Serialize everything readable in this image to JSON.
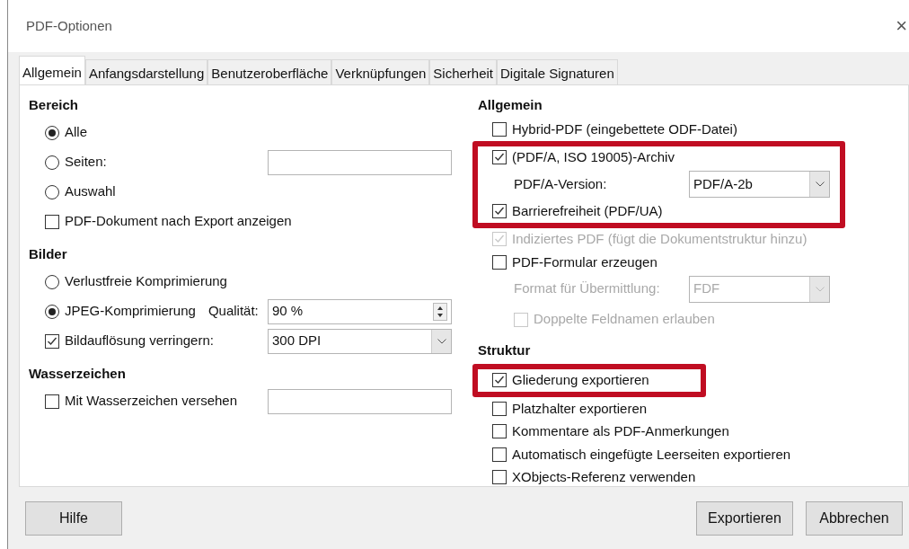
{
  "window": {
    "title": "PDF-Optionen",
    "close": "×"
  },
  "tabs": [
    {
      "label": "Allgemein",
      "selected": true
    },
    {
      "label": "Anfangsdarstellung",
      "selected": false
    },
    {
      "label": "Benutzeroberfläche",
      "selected": false
    },
    {
      "label": "Verknüpfungen",
      "selected": false
    },
    {
      "label": "Sicherheit",
      "selected": false
    },
    {
      "label": "Digitale Signaturen",
      "selected": false
    }
  ],
  "left_sections": [
    {
      "heading": "Bereich",
      "items": [
        {
          "kind": "radio",
          "label": "Alle",
          "selected": true
        },
        {
          "kind": "radio",
          "label": "Seiten:",
          "selected": false,
          "field": {
            "kind": "text"
          }
        },
        {
          "kind": "radio",
          "label": "Auswahl",
          "selected": false
        },
        {
          "kind": "checkbox",
          "label": "PDF-Dokument nach Export anzeigen",
          "checked": false
        }
      ]
    },
    {
      "heading": "Bilder",
      "items": [
        {
          "kind": "radio",
          "label": "Verlustfreie Komprimierung",
          "selected": false
        },
        {
          "kind": "radio",
          "label": "JPEG-Komprimierung",
          "selected": true,
          "field_label": "Qualität:",
          "field": {
            "kind": "spin",
            "value": "90 %"
          }
        },
        {
          "kind": "checkbox",
          "label": "Bildauflösung verringern:",
          "checked": true,
          "field": {
            "kind": "select",
            "value": "300 DPI"
          }
        }
      ]
    },
    {
      "heading": "Wasserzeichen",
      "items": [
        {
          "kind": "checkbox",
          "label": "Mit Wasserzeichen versehen",
          "checked": false,
          "field": {
            "kind": "text"
          }
        }
      ]
    }
  ],
  "right_sections": [
    {
      "heading": "Allgemein",
      "items": [
        {
          "kind": "checkbox",
          "label": "Hybrid-PDF (eingebettete ODF-Datei)",
          "checked": false,
          "disabled": false,
          "highlighted": false
        },
        {
          "kind": "checkbox",
          "label": "(PDF/A, ISO 19005)-Archiv",
          "checked": true,
          "disabled": false,
          "highlighted": true
        },
        {
          "kind": "select",
          "label": "PDF/A-Version:",
          "value": "PDF/A-2b",
          "disabled": false,
          "highlighted": true
        },
        {
          "kind": "checkbox",
          "label": "Barrierefreiheit (PDF/UA)",
          "checked": true,
          "disabled": false,
          "highlighted": true
        },
        {
          "kind": "checkbox",
          "label": "Indiziertes PDF (fügt die Dokumentstruktur hinzu)",
          "checked": true,
          "disabled": true,
          "highlighted": false
        },
        {
          "kind": "checkbox",
          "label": "PDF-Formular erzeugen",
          "checked": false,
          "disabled": false,
          "highlighted": false
        },
        {
          "kind": "select",
          "label": "Format für Übermittlung:",
          "value": "FDF",
          "disabled": true,
          "highlighted": false
        },
        {
          "kind": "subcheckbox",
          "label": "Doppelte Feldnamen erlauben",
          "checked": false,
          "disabled": true,
          "highlighted": false
        }
      ]
    },
    {
      "heading": "Struktur",
      "items": [
        {
          "kind": "checkbox",
          "label": "Gliederung exportieren",
          "checked": true,
          "disabled": false,
          "highlighted": true
        },
        {
          "kind": "checkbox",
          "label": "Platzhalter exportieren",
          "checked": false,
          "disabled": false,
          "highlighted": false
        },
        {
          "kind": "checkbox",
          "label": "Kommentare als PDF-Anmerkungen",
          "checked": false,
          "disabled": false,
          "highlighted": false
        },
        {
          "kind": "checkbox",
          "label": "Automatisch eingefügte Leerseiten exportieren",
          "checked": false,
          "disabled": false,
          "highlighted": false
        },
        {
          "kind": "checkbox",
          "label": "XObjects-Referenz verwenden",
          "checked": false,
          "disabled": false,
          "highlighted": false
        }
      ]
    }
  ],
  "buttons_left": [
    "Hilfe"
  ],
  "buttons_right": [
    "Exportieren",
    "Abbrechen"
  ]
}
